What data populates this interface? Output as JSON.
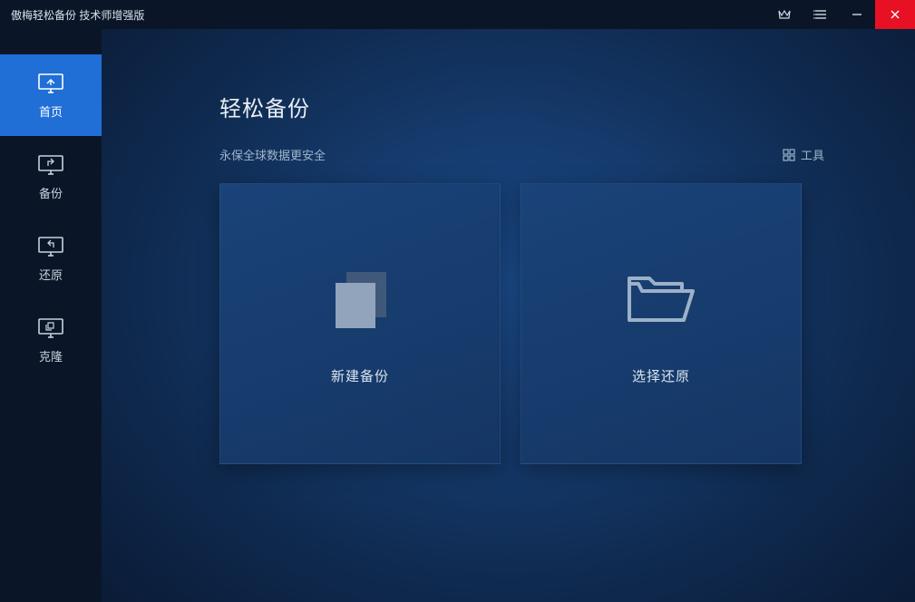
{
  "titlebar": {
    "title": "傲梅轻松备份 技术师增强版"
  },
  "sidebar": {
    "items": [
      {
        "label": "首页",
        "icon": "home-monitor",
        "active": true
      },
      {
        "label": "备份",
        "icon": "backup-monitor",
        "active": false
      },
      {
        "label": "还原",
        "icon": "restore-monitor",
        "active": false
      },
      {
        "label": "克隆",
        "icon": "clone-monitor",
        "active": false
      }
    ]
  },
  "content": {
    "heading": "轻松备份",
    "subheading": "永保全球数据更安全",
    "tools_label": "工具"
  },
  "cards": {
    "new_backup": "新建备份",
    "choose_restore": "选择还原"
  }
}
